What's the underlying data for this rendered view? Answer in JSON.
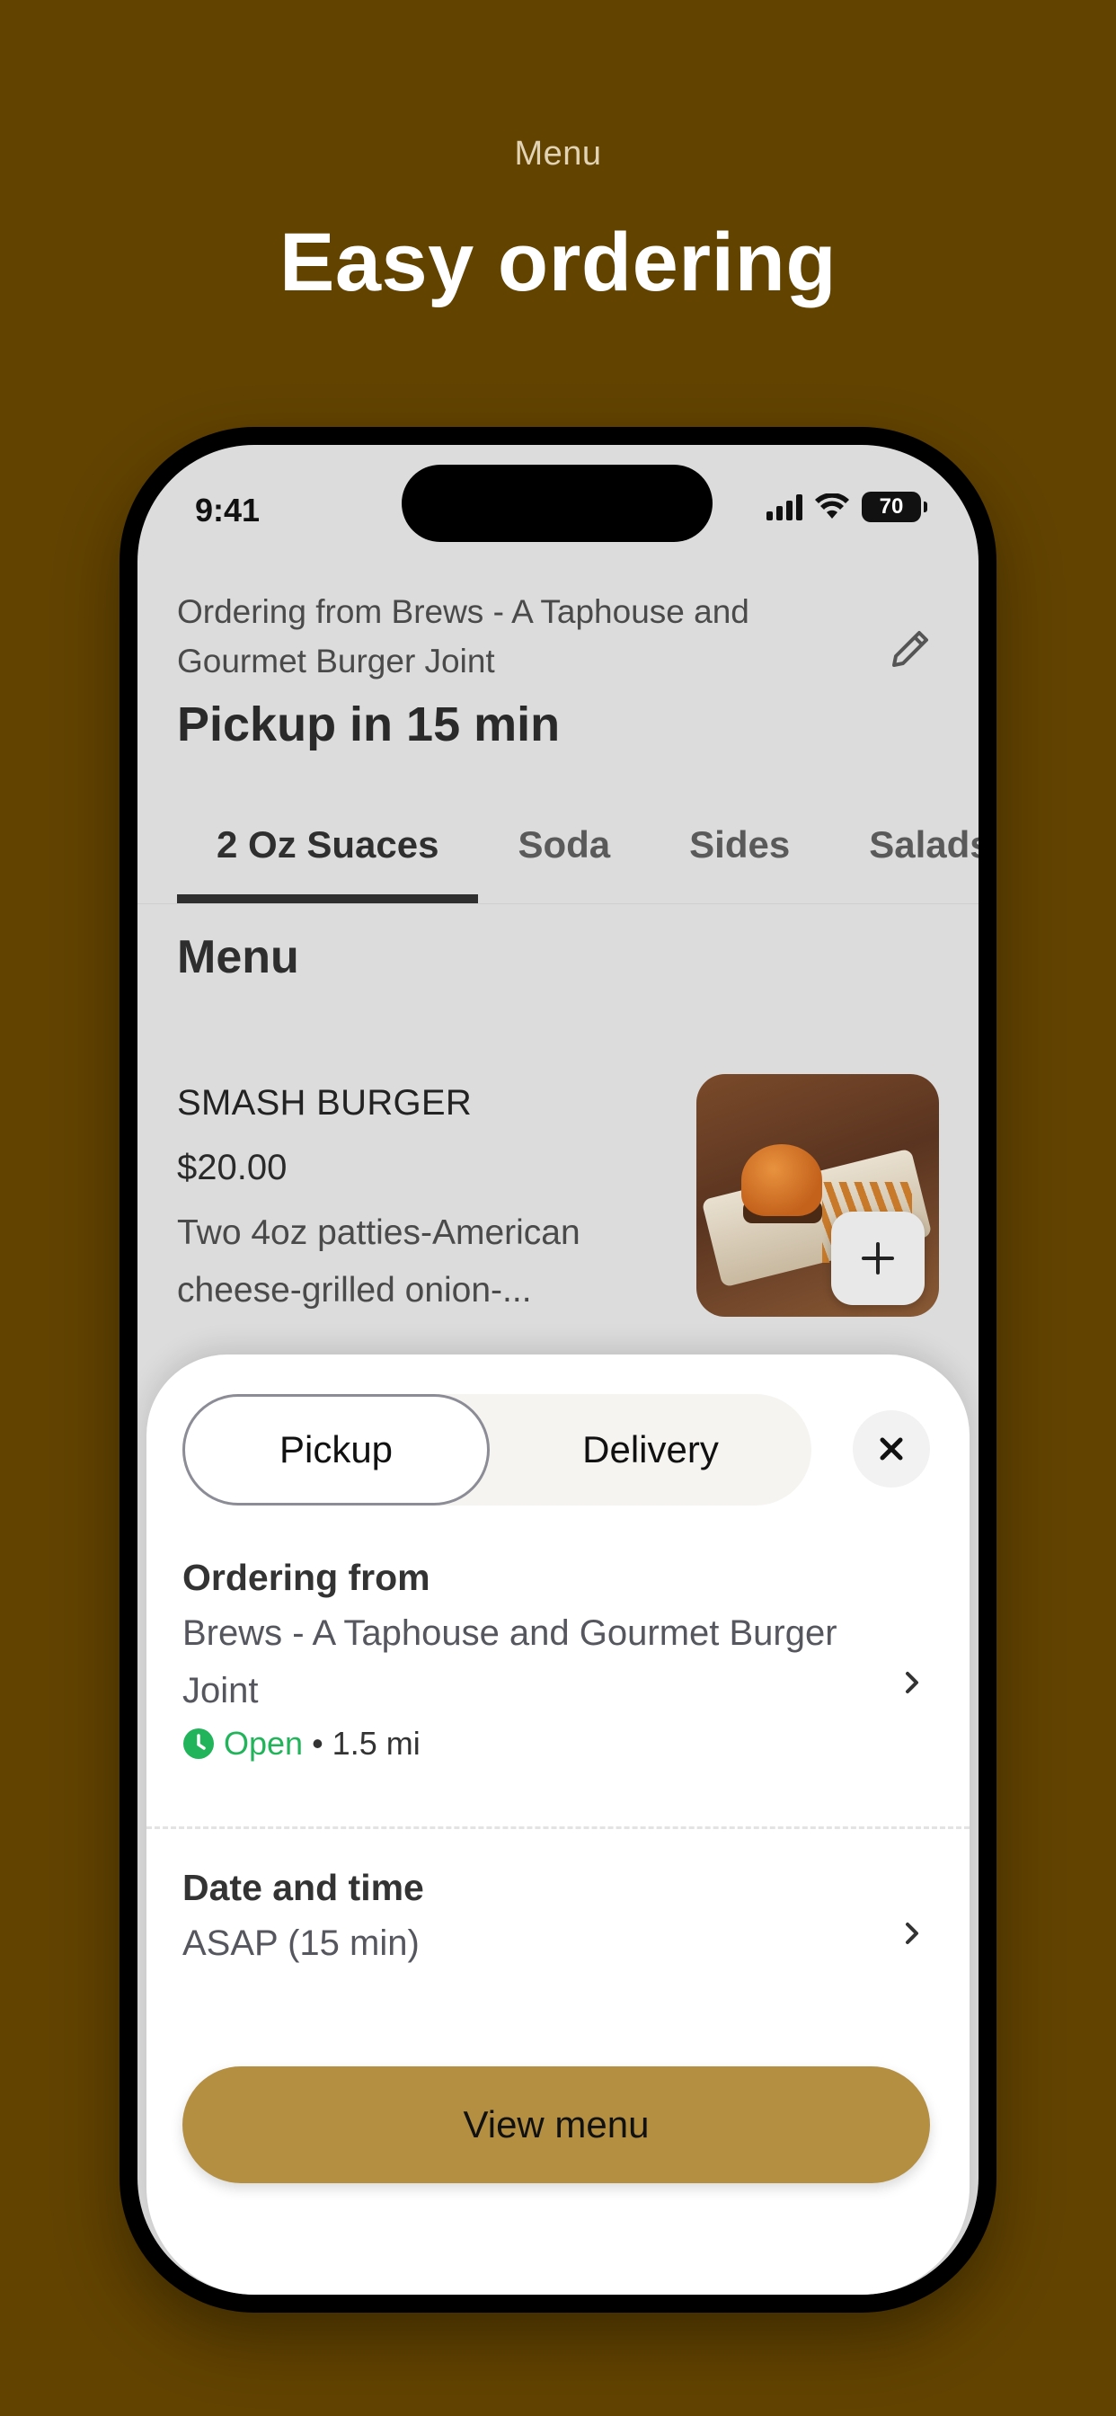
{
  "hero": {
    "eyebrow": "Menu",
    "title": "Easy ordering"
  },
  "status_bar": {
    "time": "9:41",
    "battery": "70"
  },
  "header": {
    "ordering_from": "Ordering from Brews - A Taphouse and Gourmet Burger Joint",
    "pickup_time": "Pickup in 15 min",
    "edit_icon": "pencil-icon"
  },
  "tabs": [
    {
      "label": "2 Oz Suaces",
      "active": true
    },
    {
      "label": "Soda"
    },
    {
      "label": "Sides"
    },
    {
      "label": "Salads"
    }
  ],
  "menu": {
    "heading": "Menu",
    "item": {
      "name": "SMASH BURGER",
      "price": "$20.00",
      "description": "Two 4oz patties-American cheese-grilled onion-..."
    }
  },
  "sheet": {
    "modes": {
      "pickup": "Pickup",
      "delivery": "Delivery",
      "selected": "pickup"
    },
    "ordering_from": {
      "title": "Ordering from",
      "value": "Brews - A Taphouse and Gourmet Burger Joint",
      "status": "Open",
      "distance": "• 1.5 mi"
    },
    "date_time": {
      "title": "Date and time",
      "value": "ASAP (15 min)"
    },
    "cta": "View menu"
  },
  "colors": {
    "background": "#624300",
    "accent": "#b48f42",
    "open_green": "#22b45a"
  }
}
